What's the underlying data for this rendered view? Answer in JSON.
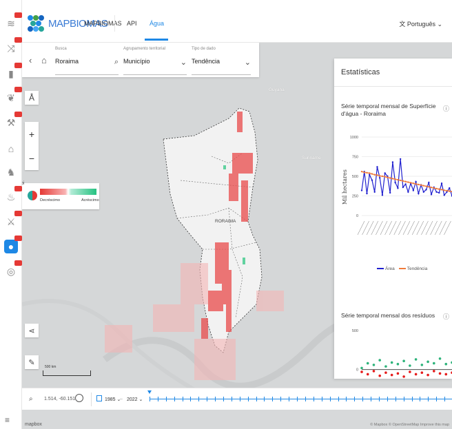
{
  "header": {
    "logo_text": "MAPBIOMAS",
    "nav": [
      "MAPBIOMAS",
      "API",
      "Água"
    ],
    "active_nav": "Água",
    "language": "Português"
  },
  "filters": {
    "busca": {
      "label": "Busca",
      "value": "Roraima"
    },
    "agrupamento": {
      "label": "Agrupamento territorial",
      "value": "Município"
    },
    "tipo": {
      "label": "Tipo de dado",
      "value": "Tendência"
    }
  },
  "map": {
    "labels": {
      "guyana": "Guyana",
      "suriname": "Suriname",
      "roraima": "RORAIMA"
    },
    "scale": "500 km",
    "legend": {
      "low": "Decréscimo",
      "high": "Acréscimo",
      "low_color": "#e53935",
      "high_color": "#26c281"
    },
    "coords": "1.514, -60.151",
    "year_from": "1985",
    "year_to": "2022",
    "attribution": "© Mapbox © OpenStreetMap Improve this map",
    "footer_logo": "mapbox"
  },
  "stats": {
    "title": "Estatísticas",
    "chart1_title": "Série temporal mensal de Superfície d'água - Roraima",
    "chart2_title": "Série temporal mensal dos resíduos",
    "legend": [
      "Área",
      "Tendência"
    ],
    "colors": {
      "area": "#1f1fcf",
      "trend": "#f07a3a",
      "resid_pos": "#2db37a",
      "resid_neg": "#e51c1c"
    }
  },
  "chart_data": [
    {
      "type": "line",
      "title": "Série temporal mensal de Superfície d'água - Roraima",
      "ylabel": "Mil hectares",
      "ylim": [
        0,
        1000
      ],
      "yticks": [
        0,
        250,
        500,
        750,
        1000
      ],
      "series": [
        {
          "name": "Área",
          "values": [
            320,
            560,
            280,
            520,
            450,
            300,
            620,
            480,
            260,
            540,
            500,
            290,
            680,
            420,
            350,
            720,
            360,
            400,
            300,
            410,
            320,
            430,
            280,
            390,
            300,
            330,
            420,
            270,
            360,
            300,
            290,
            410,
            260,
            300,
            350,
            250
          ]
        },
        {
          "name": "Tendência",
          "values": [
            560,
            550,
            545,
            540,
            530,
            520,
            515,
            505,
            500,
            495,
            485,
            478,
            470,
            462,
            455,
            448,
            440,
            432,
            425,
            418,
            410,
            402,
            395,
            388,
            380,
            373,
            366,
            358,
            350,
            343,
            336,
            330,
            322,
            316,
            310,
            304
          ]
        }
      ]
    },
    {
      "type": "scatter",
      "title": "Série temporal mensal dos resíduos",
      "ylim": [
        -100,
        500
      ],
      "yticks": [
        0,
        500
      ],
      "series": [
        {
          "name": "",
          "values": [
            20,
            80,
            60,
            120,
            40,
            90,
            70,
            110,
            50,
            130,
            60,
            100,
            80,
            140,
            70,
            90
          ]
        },
        {
          "name": "",
          "values": [
            -30,
            -60,
            -20,
            -80,
            -40,
            -70,
            -50,
            -90,
            -30,
            -60,
            -40,
            -70,
            -20,
            -50,
            -60,
            -40
          ]
        }
      ]
    }
  ]
}
